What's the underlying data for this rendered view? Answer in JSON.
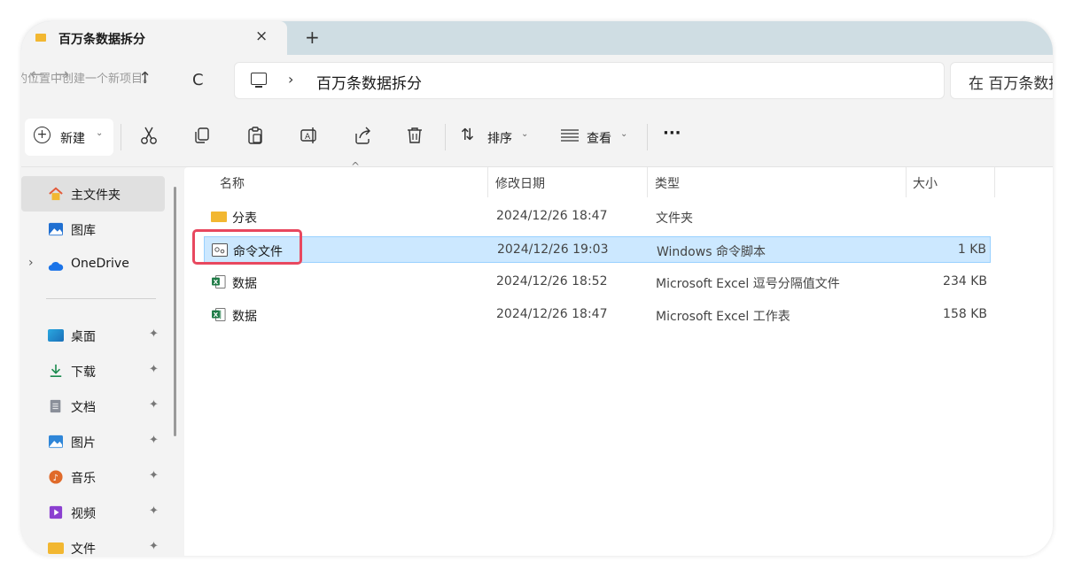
{
  "window": {
    "tab_title": "百万条数据拆分",
    "tab_close": "×",
    "new_tab": "+"
  },
  "nav": {
    "tooltip": "的位置中创建一个新项目。",
    "back": "←",
    "forward": "→",
    "up": "↑",
    "refresh": "C",
    "separator": "›",
    "path": "百万条数据拆分",
    "search_placeholder": "在 百万条数据"
  },
  "toolbar": {
    "new_label": "新建",
    "sort_label": "排序",
    "view_label": "查看",
    "more": "···"
  },
  "sidebar": {
    "items": [
      {
        "label": "主文件夹",
        "icon": "home-icon",
        "color": "#e35a3a"
      },
      {
        "label": "图库",
        "icon": "gallery-icon",
        "color": "#1f6fd1"
      },
      {
        "label": "OneDrive",
        "icon": "cloud-icon",
        "color": "#1a73e8"
      }
    ],
    "quick": [
      {
        "label": "桌面",
        "icon": "desktop-icon",
        "color": "#2aa8e0"
      },
      {
        "label": "下载",
        "icon": "download-icon",
        "color": "#1a8a4e"
      },
      {
        "label": "文档",
        "icon": "document-icon",
        "color": "#8a8f99"
      },
      {
        "label": "图片",
        "icon": "pictures-icon",
        "color": "#2f86d8"
      },
      {
        "label": "音乐",
        "icon": "music-icon",
        "color": "#e06a2a"
      },
      {
        "label": "视频",
        "icon": "video-icon",
        "color": "#8b3fd0"
      },
      {
        "label": "文件",
        "icon": "folder-icon",
        "color": "#f2b731"
      }
    ],
    "pin": "📌"
  },
  "columns": {
    "name": "名称",
    "date": "修改日期",
    "type": "类型",
    "size": "大小"
  },
  "files": [
    {
      "name": "分表",
      "date": "2024/12/26 18:47",
      "type": "文件夹",
      "size": "",
      "icon": "folder-icon"
    },
    {
      "name": "命令文件",
      "date": "2024/12/26 19:03",
      "type": "Windows 命令脚本",
      "size": "1 KB",
      "icon": "script-icon"
    },
    {
      "name": "数据",
      "date": "2024/12/26 18:52",
      "type": "Microsoft Excel 逗号分隔值文件",
      "size": "234 KB",
      "icon": "excel-csv-icon"
    },
    {
      "name": "数据",
      "date": "2024/12/26 18:47",
      "type": "Microsoft Excel 工作表",
      "size": "158 KB",
      "icon": "excel-icon"
    }
  ],
  "colors": {
    "accent": "#0067c0",
    "selection": "#cce8ff",
    "highlight_box": "#e8485f"
  }
}
